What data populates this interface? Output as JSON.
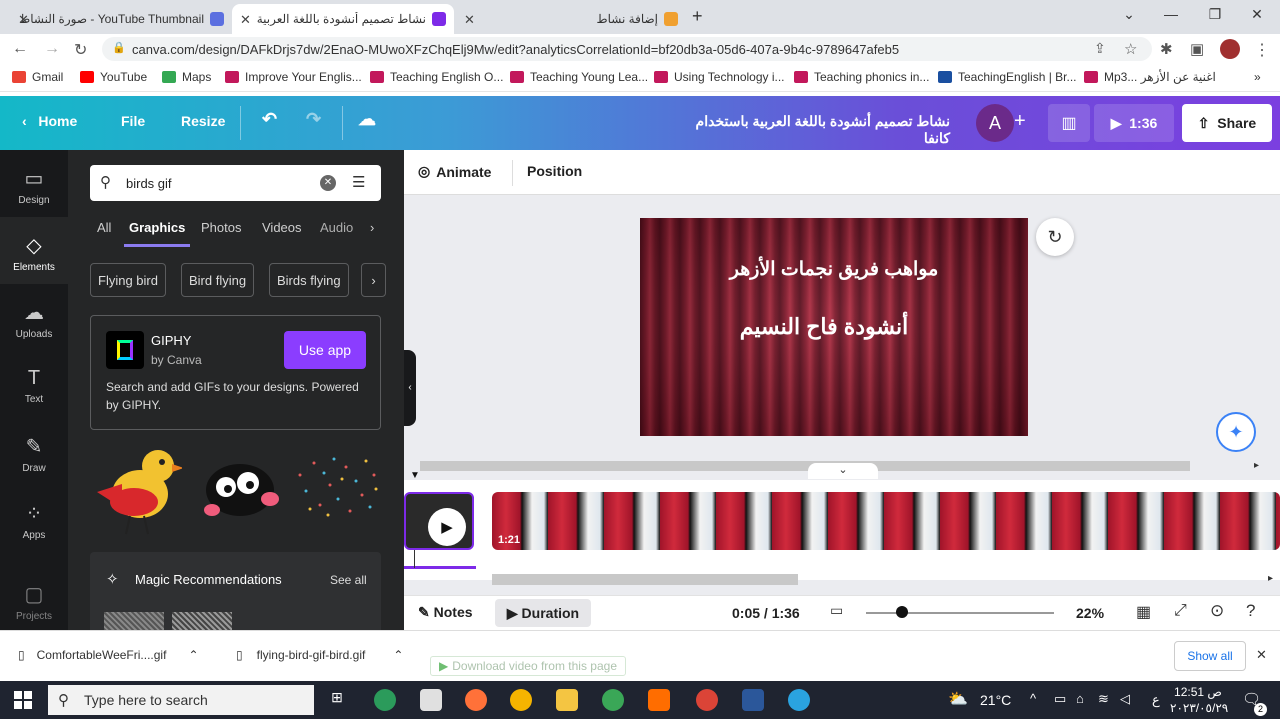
{
  "tabs": [
    {
      "title": "YouTube Thumbnail - صورة النشاط",
      "active": false
    },
    {
      "title": "نشاط تصميم أنشودة باللغة العربية",
      "active": true
    },
    {
      "title": "",
      "active": false
    },
    {
      "title": "إضافة نشاط",
      "active": false
    }
  ],
  "address": {
    "url": "canva.com/design/DAFkDrjs7dw/2EnaO-MUwoXFzChqElj9Mw/edit?analyticsCorrelationId=bf20db3a-05d6-407a-9b4c-9789647afeb5"
  },
  "bookmarks": [
    "Gmail",
    "YouTube",
    "Maps",
    "Improve Your Englis...",
    "Teaching English O...",
    "Teaching Young Lea...",
    "Using Technology i...",
    "Teaching phonics in...",
    "TeachingEnglish | Br...",
    "Mp3... اغنية عن الأزهر"
  ],
  "header": {
    "home": "Home",
    "file": "File",
    "resize": "Resize",
    "title": "نشاط تصميم أنشودة باللغة العربية باستخدام كانفا",
    "avatar_letter": "A",
    "play_time": "1:36",
    "share": "Share"
  },
  "rail": [
    {
      "label": "Design",
      "icon": "▭"
    },
    {
      "label": "Elements",
      "icon": "◇"
    },
    {
      "label": "Uploads",
      "icon": "☁"
    },
    {
      "label": "Text",
      "icon": "T"
    },
    {
      "label": "Draw",
      "icon": "✎"
    },
    {
      "label": "Apps",
      "icon": "⁘"
    },
    {
      "label": "Projects",
      "icon": "▢"
    }
  ],
  "panel": {
    "search_value": "birds gif",
    "tabs": [
      "All",
      "Graphics",
      "Photos",
      "Videos",
      "Audio"
    ],
    "chips": [
      "Flying bird",
      "Bird flying",
      "Birds flying"
    ],
    "giphy": {
      "name": "GIPHY",
      "by": "by Canva",
      "button": "Use app",
      "desc": "Search and add GIFs to your designs. Powered by GIPHY."
    },
    "magic": {
      "title": "Magic Recommendations",
      "see_all": "See all"
    }
  },
  "toolbar": {
    "animate": "Animate",
    "position": "Position"
  },
  "slide": {
    "line1": "مواهب فريق نجمات الأزهر",
    "line2": "أنشودة فاح النسيم"
  },
  "timeline": {
    "clip_time": "1:21"
  },
  "bottom": {
    "notes": "Notes",
    "duration": "Duration",
    "time": "0:05 / 1:36",
    "zoom": "22%"
  },
  "downloads": {
    "file1": "ComfortableWeeFri....gif",
    "file2": "flying-bird-gif-bird.gif",
    "overlay": "Download video from this page",
    "show_all": "Show all"
  },
  "taskbar": {
    "search_placeholder": "Type here to search",
    "temp": "21°C",
    "time": "12:51 ص",
    "date": "٢٠٢٣/٠٥/٢٩",
    "lang": "ع",
    "notif": "2"
  }
}
